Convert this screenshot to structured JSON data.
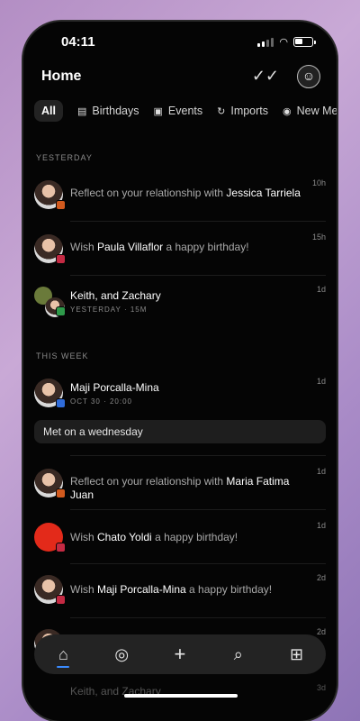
{
  "status": {
    "time": "04:11"
  },
  "header": {
    "title": "Home"
  },
  "filters": [
    {
      "label": "All",
      "icon": ""
    },
    {
      "label": "Birthdays",
      "icon": "gift-icon"
    },
    {
      "label": "Events",
      "icon": "calendar-icon"
    },
    {
      "label": "Imports",
      "icon": "refresh-icon"
    },
    {
      "label": "New Mem",
      "icon": "dot-icon"
    }
  ],
  "sections": {
    "yesterday": "YESTERDAY",
    "this_week": "THIS WEEK"
  },
  "items": [
    {
      "pre": "Reflect on your relationship with ",
      "name": "Jessica Tarriela",
      "post": "",
      "ago": "10h",
      "badge_color": "#d25a1e"
    },
    {
      "pre": "Wish ",
      "name": "Paula Villaflor",
      "post": " a happy birthday!",
      "ago": "15h",
      "badge_color": "#c42a43"
    },
    {
      "name": "Keith, and Zachary",
      "sub": "YESTERDAY · 15M",
      "ago": "1d",
      "badge_color": "#2e9a4a"
    },
    {
      "name": "Maji Porcalla-Mina",
      "sub": "OCT 30 · 20:00",
      "ago": "1d",
      "badge_color": "#2f6bd8",
      "note": "Met on a wednesday"
    },
    {
      "pre": "Reflect on your relationship with ",
      "name": "Maria Fatima Juan",
      "post": "",
      "ago": "1d",
      "badge_color": "#d25a1e"
    },
    {
      "pre": "Wish ",
      "name": "Chato Yoldi",
      "post": " a happy birthday!",
      "ago": "1d",
      "badge_color": "#c42a43"
    },
    {
      "pre": "Wish ",
      "name": "Maji Porcalla-Mina",
      "post": " a happy birthday!",
      "ago": "2d",
      "badge_color": "#c42a43"
    },
    {
      "ago": "2d"
    },
    {
      "name": "Keith, and Zachary",
      "ago": "3d"
    }
  ]
}
